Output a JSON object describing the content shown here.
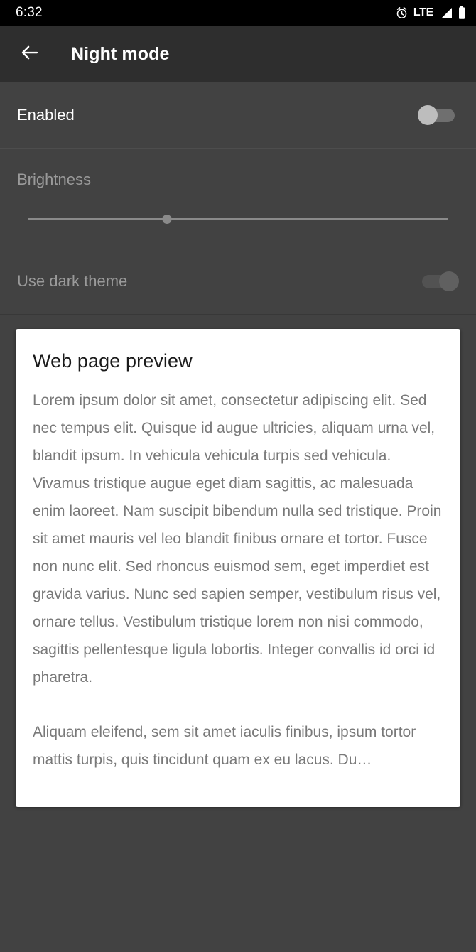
{
  "status_bar": {
    "time": "6:32",
    "network_label": "LTE",
    "icons": [
      "alarm-icon",
      "lte-label",
      "signal-icon",
      "battery-icon"
    ],
    "background": "#000000",
    "foreground": "#ffffff"
  },
  "app_bar": {
    "back_icon": "back-arrow-icon",
    "title": "Night mode",
    "background": "#2e2e2e"
  },
  "settings": {
    "enabled": {
      "label": "Enabled",
      "switch_state": "off",
      "enabled": true
    },
    "brightness": {
      "label": "Brightness",
      "enabled": false,
      "slider_value_percent": 33
    },
    "dark_theme": {
      "label": "Use dark theme",
      "switch_state": "on",
      "enabled": false
    }
  },
  "preview_card": {
    "title": "Web page preview",
    "paragraph_1": "Lorem ipsum dolor sit amet, consectetur adipiscing elit. Sed nec tempus elit. Quisque id augue ultricies, aliquam urna vel, blandit ipsum. In vehicula vehicula turpis sed vehicula. Vivamus tristique augue eget diam sagittis, ac malesuada enim laoreet. Nam suscipit bibendum nulla sed tristique. Proin sit amet mauris vel leo blandit finibus ornare et tortor. Fusce non nunc elit. Sed rhoncus euismod sem, eget imperdiet est gravida varius. Nunc sed sapien semper, vestibulum risus vel, ornare tellus. Vestibulum tristique lorem non nisi commodo, sagittis pellentesque ligula lobortis. Integer convallis id orci id pharetra.",
    "paragraph_2": "Aliquam eleifend, sem sit amet iaculis finibus, ipsum tortor mattis turpis, quis tincidunt quam ex eu lacus. Du…",
    "background": "#ffffff",
    "title_color": "#1a1a1a",
    "body_color": "#797979"
  },
  "theme": {
    "page_background": "#424242",
    "divider": "#4d4d4d",
    "switch_off_thumb": "#bdbdbd",
    "switch_off_track": "#6f6f6f",
    "switch_on_disabled_thumb": "#606060",
    "slider_color": "#8a8a8a",
    "dim_text": "#9a9a9a"
  }
}
